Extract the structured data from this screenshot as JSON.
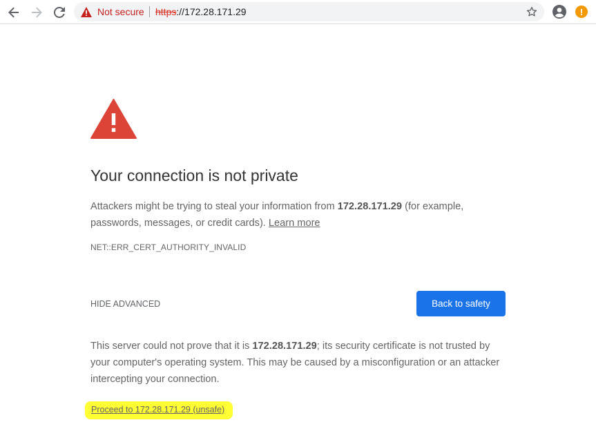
{
  "browser": {
    "security_label": "Not secure",
    "url_scheme": "https",
    "url_rest": "://172.28.171.29",
    "update_badge": "!"
  },
  "interstitial": {
    "heading": "Your connection is not private",
    "explain_prefix": "Attackers might be trying to steal your information from ",
    "host": "172.28.171.29",
    "explain_suffix": " (for example, passwords, messages, or credit cards). ",
    "learn_more": "Learn more",
    "error_code": "NET::ERR_CERT_AUTHORITY_INVALID",
    "hide_advanced": "HIDE ADVANCED",
    "back_button": "Back to safety",
    "details_prefix": "This server could not prove that it is ",
    "details_suffix": "; its security certificate is not trusted by your computer's operating system. This may be caused by a misconfiguration or an attacker intercepting your connection.",
    "proceed_link": "Proceed to 172.28.171.29 (unsafe)"
  },
  "colors": {
    "warning_red": "#db4437",
    "primary_blue": "#1a73e8",
    "highlight_yellow": "#ffff33"
  },
  "icons": {
    "back": "arrow-left-icon",
    "forward": "arrow-right-icon",
    "reload": "reload-icon",
    "security": "warning-triangle-icon",
    "bookmark": "star-icon",
    "profile": "account-circle-icon",
    "update": "update-alert-icon",
    "page_warning": "large-warning-triangle-icon"
  }
}
